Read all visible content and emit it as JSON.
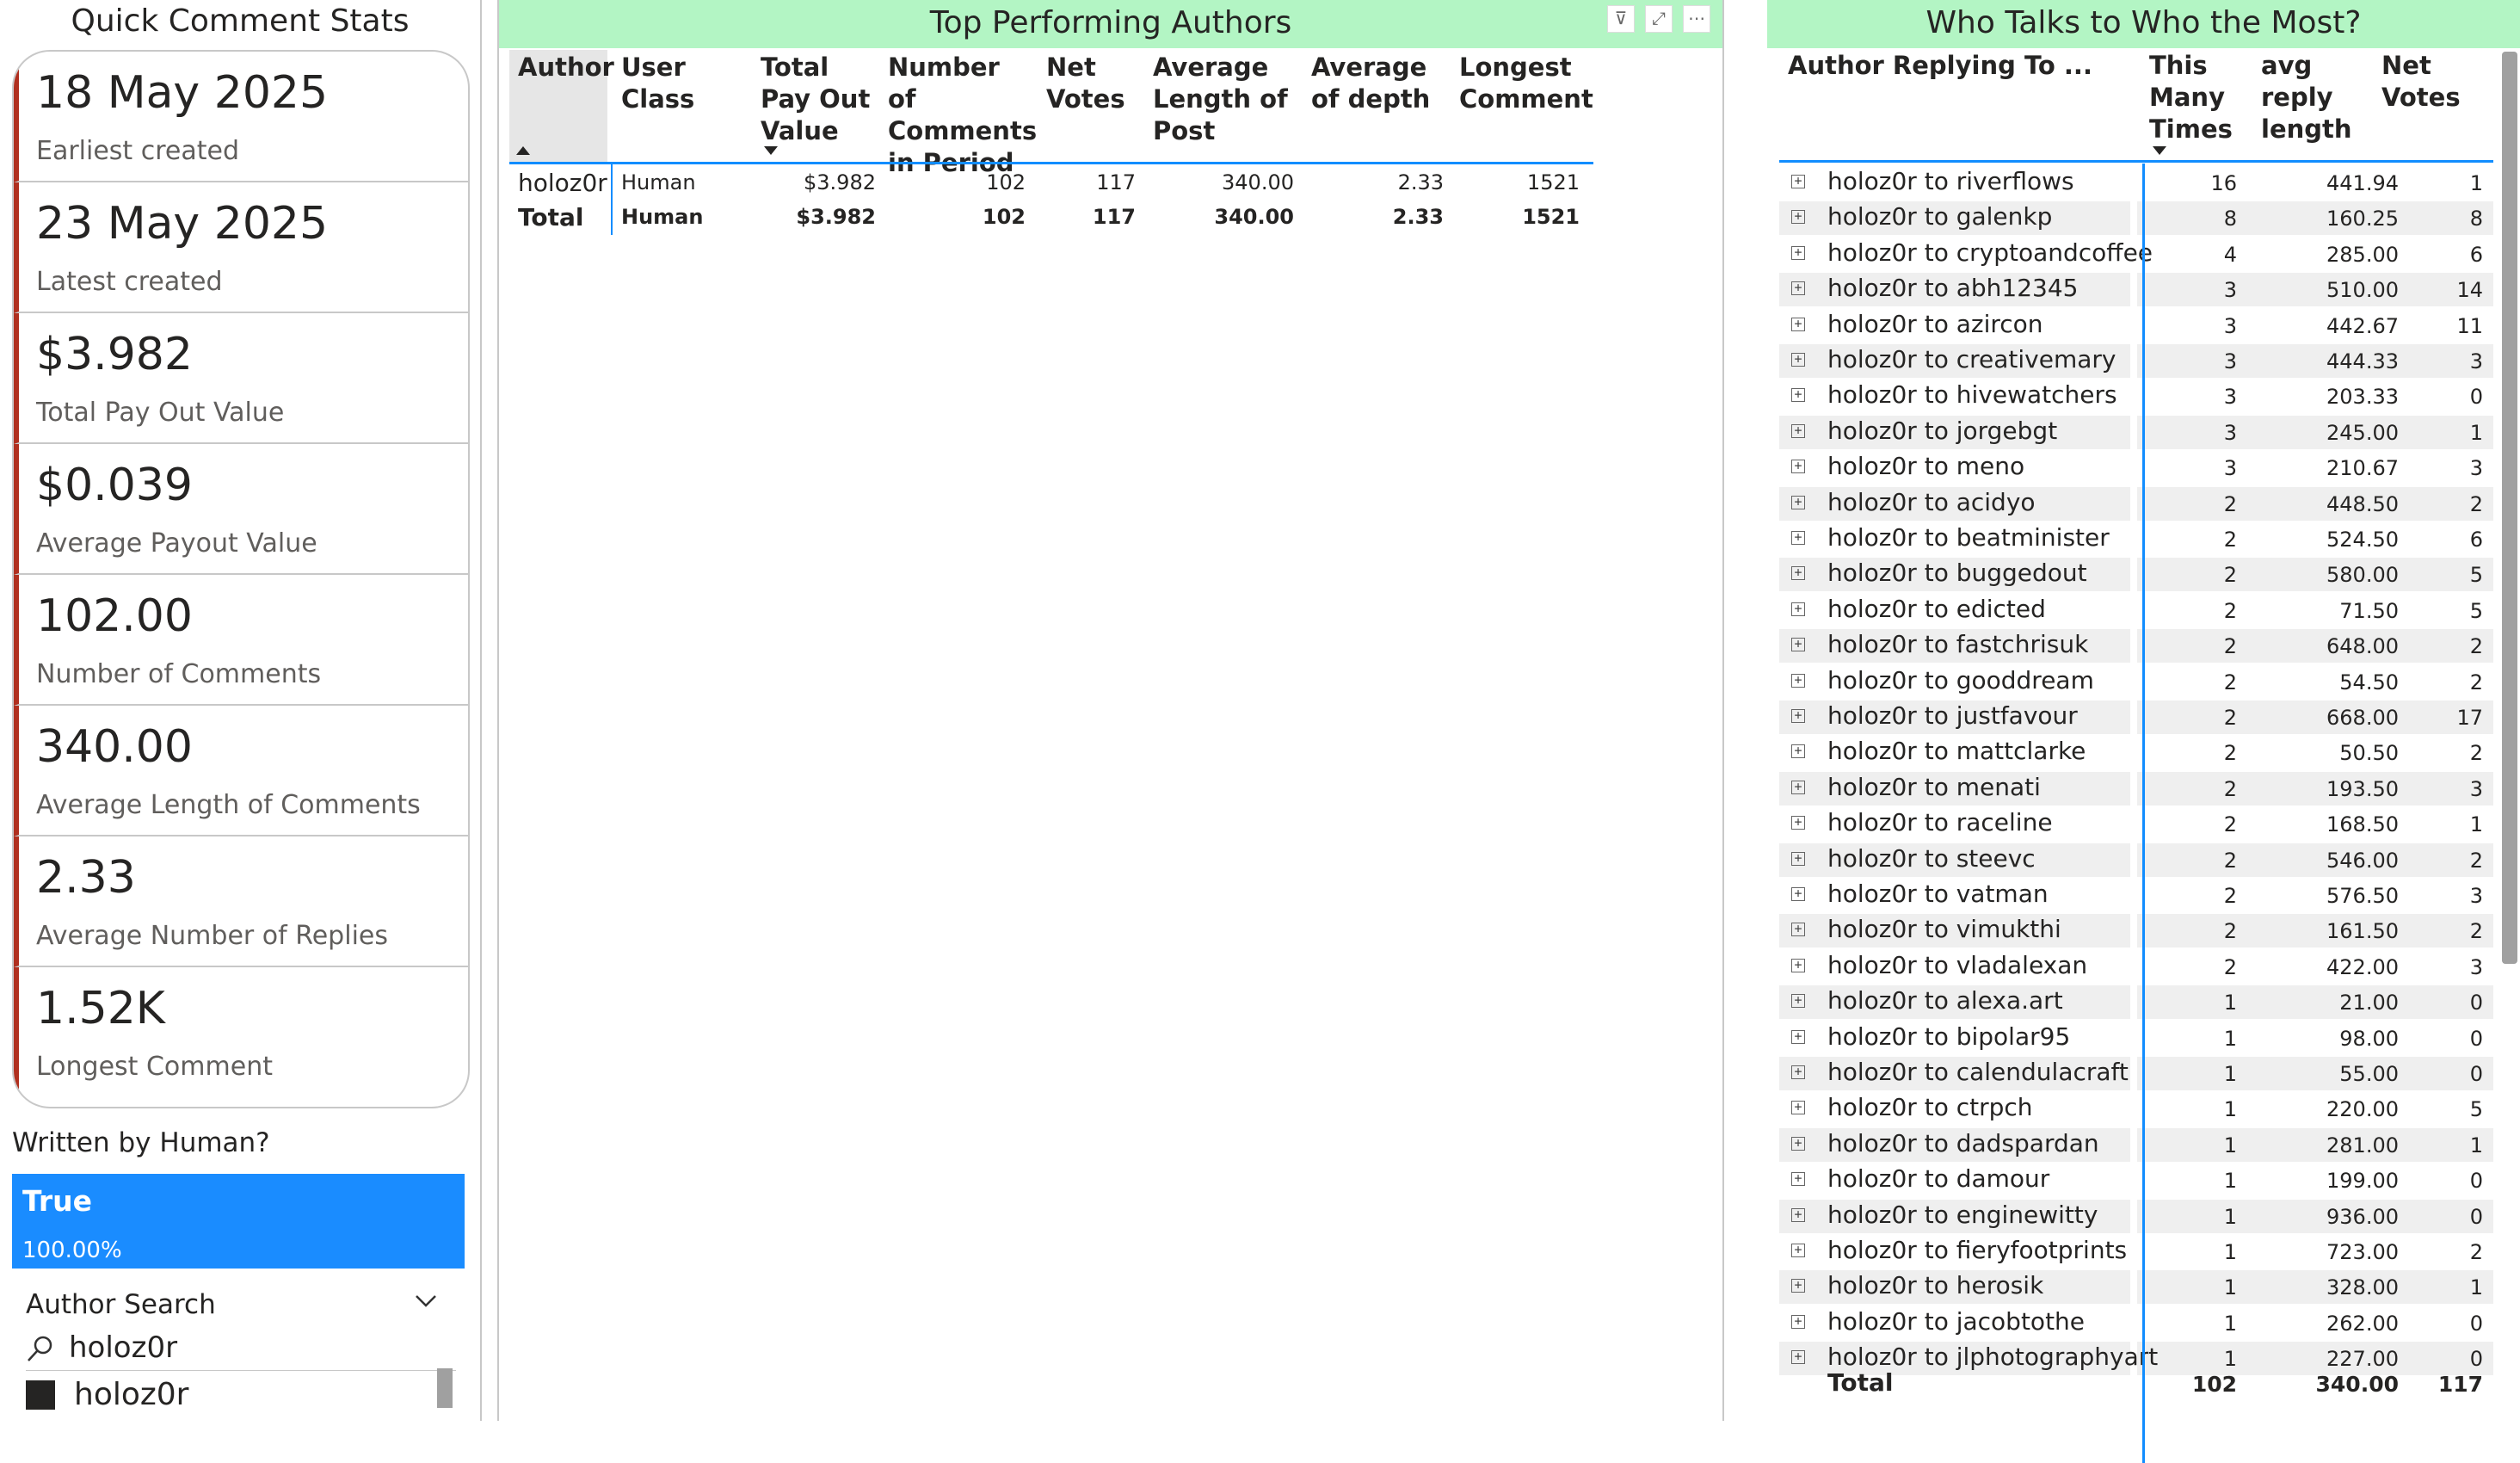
{
  "left_panel": {
    "title": "Quick Comment Stats",
    "kpis": [
      {
        "value": "18 May 2025",
        "label": "Earliest created"
      },
      {
        "value": "23 May 2025",
        "label": "Latest created"
      },
      {
        "value": "$3.982",
        "label": "Total Pay Out Value"
      },
      {
        "value": "$0.039",
        "label": "Average Payout Value"
      },
      {
        "value": "102.00",
        "label": "Number of Comments"
      },
      {
        "value": "340.00",
        "label": "Average Length of Comments"
      },
      {
        "value": "2.33",
        "label": "Average Number of Replies"
      },
      {
        "value": "1.52K",
        "label": "Longest Comment"
      }
    ],
    "human_slicer": {
      "title": "Written by Human?",
      "option": "True",
      "percent": "100.00%"
    },
    "author_search": {
      "title": "Author Search",
      "query": "holoz0r",
      "option": "holoz0r"
    }
  },
  "mid_panel": {
    "title": "Top Performing Authors",
    "headers": {
      "author": "Author",
      "user_class": "User Class",
      "total_pay": "Total Pay Out Value",
      "num_comments": "Number of Comments in Period",
      "net_votes": "Net Votes",
      "avg_length": "Average Length of Post",
      "avg_depth": "Average of depth",
      "longest": "Longest Comment"
    },
    "row": {
      "author": "holoz0r",
      "user_class": "Human",
      "total_pay": "$3.982",
      "num_comments": "102",
      "net_votes": "117",
      "avg_length": "340.00",
      "avg_depth": "2.33",
      "longest": "1521"
    },
    "total": {
      "author": "Total",
      "user_class": "Human",
      "total_pay": "$3.982",
      "num_comments": "102",
      "net_votes": "117",
      "avg_length": "340.00",
      "avg_depth": "2.33",
      "longest": "1521"
    }
  },
  "right_panel": {
    "title": "Who Talks to Who the Most?",
    "headers": {
      "pair": "Author Replying To ...",
      "times": "This Many Times",
      "avg_len": "avg reply length",
      "net_votes": "Net Votes"
    },
    "rows": [
      {
        "pair": "holoz0r to riverflows",
        "times": "16",
        "avg": "441.94",
        "votes": "1"
      },
      {
        "pair": "holoz0r to galenkp",
        "times": "8",
        "avg": "160.25",
        "votes": "8"
      },
      {
        "pair": "holoz0r to cryptoandcoffee",
        "times": "4",
        "avg": "285.00",
        "votes": "6"
      },
      {
        "pair": "holoz0r to abh12345",
        "times": "3",
        "avg": "510.00",
        "votes": "14"
      },
      {
        "pair": "holoz0r to azircon",
        "times": "3",
        "avg": "442.67",
        "votes": "11"
      },
      {
        "pair": "holoz0r to creativemary",
        "times": "3",
        "avg": "444.33",
        "votes": "3"
      },
      {
        "pair": "holoz0r to hivewatchers",
        "times": "3",
        "avg": "203.33",
        "votes": "0"
      },
      {
        "pair": "holoz0r to jorgebgt",
        "times": "3",
        "avg": "245.00",
        "votes": "1"
      },
      {
        "pair": "holoz0r to meno",
        "times": "3",
        "avg": "210.67",
        "votes": "3"
      },
      {
        "pair": "holoz0r to acidyo",
        "times": "2",
        "avg": "448.50",
        "votes": "2"
      },
      {
        "pair": "holoz0r to beatminister",
        "times": "2",
        "avg": "524.50",
        "votes": "6"
      },
      {
        "pair": "holoz0r to buggedout",
        "times": "2",
        "avg": "580.00",
        "votes": "5"
      },
      {
        "pair": "holoz0r to edicted",
        "times": "2",
        "avg": "71.50",
        "votes": "5"
      },
      {
        "pair": "holoz0r to fastchrisuk",
        "times": "2",
        "avg": "648.00",
        "votes": "2"
      },
      {
        "pair": "holoz0r to gooddream",
        "times": "2",
        "avg": "54.50",
        "votes": "2"
      },
      {
        "pair": "holoz0r to justfavour",
        "times": "2",
        "avg": "668.00",
        "votes": "17"
      },
      {
        "pair": "holoz0r to mattclarke",
        "times": "2",
        "avg": "50.50",
        "votes": "2"
      },
      {
        "pair": "holoz0r to menati",
        "times": "2",
        "avg": "193.50",
        "votes": "3"
      },
      {
        "pair": "holoz0r to raceline",
        "times": "2",
        "avg": "168.50",
        "votes": "1"
      },
      {
        "pair": "holoz0r to steevc",
        "times": "2",
        "avg": "546.00",
        "votes": "2"
      },
      {
        "pair": "holoz0r to vatman",
        "times": "2",
        "avg": "576.50",
        "votes": "3"
      },
      {
        "pair": "holoz0r to vimukthi",
        "times": "2",
        "avg": "161.50",
        "votes": "2"
      },
      {
        "pair": "holoz0r to vladalexan",
        "times": "2",
        "avg": "422.00",
        "votes": "3"
      },
      {
        "pair": "holoz0r to alexa.art",
        "times": "1",
        "avg": "21.00",
        "votes": "0"
      },
      {
        "pair": "holoz0r to bipolar95",
        "times": "1",
        "avg": "98.00",
        "votes": "0"
      },
      {
        "pair": "holoz0r to calendulacraft",
        "times": "1",
        "avg": "55.00",
        "votes": "0"
      },
      {
        "pair": "holoz0r to ctrpch",
        "times": "1",
        "avg": "220.00",
        "votes": "5"
      },
      {
        "pair": "holoz0r to dadspardan",
        "times": "1",
        "avg": "281.00",
        "votes": "1"
      },
      {
        "pair": "holoz0r to damour",
        "times": "1",
        "avg": "199.00",
        "votes": "0"
      },
      {
        "pair": "holoz0r to enginewitty",
        "times": "1",
        "avg": "936.00",
        "votes": "0"
      },
      {
        "pair": "holoz0r to fieryfootprints",
        "times": "1",
        "avg": "723.00",
        "votes": "2"
      },
      {
        "pair": "holoz0r to herosik",
        "times": "1",
        "avg": "328.00",
        "votes": "1"
      },
      {
        "pair": "holoz0r to jacobtothe",
        "times": "1",
        "avg": "262.00",
        "votes": "0"
      },
      {
        "pair": "holoz0r to jlphotographyart",
        "times": "1",
        "avg": "227.00",
        "votes": "0"
      }
    ],
    "total": {
      "label": "Total",
      "times": "102",
      "avg": "340.00",
      "votes": "117"
    }
  },
  "colors": {
    "accent_green": "#b3f5c4",
    "select_blue": "#1a8cff",
    "kpi_bar": "#b0301f",
    "grid_blue": "#118dff"
  },
  "icons": {
    "filter": "filter-icon",
    "focus": "focus-mode-icon",
    "more": "more-options-icon",
    "search": "search-icon",
    "chevron": "chevron-down-icon",
    "expand": "expand-plus-icon"
  }
}
